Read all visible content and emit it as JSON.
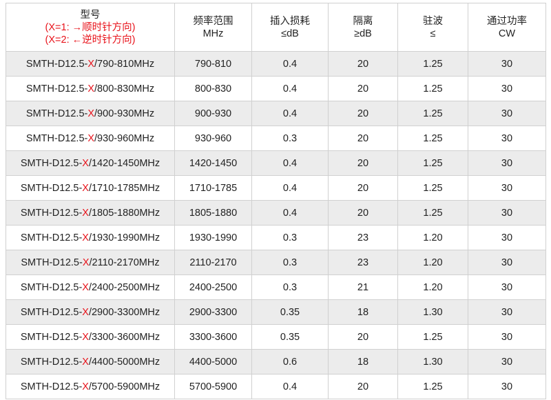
{
  "table": {
    "headers": {
      "model": {
        "title": "型号",
        "note1": "(X=1: →顺时针方向)",
        "note2": "(X=2: ←逆时针方向)"
      },
      "freq": {
        "line1": "频率范围",
        "line2": "MHz"
      },
      "loss": {
        "line1": "插入损耗",
        "line2": "≤dB"
      },
      "iso": {
        "line1": "隔离",
        "line2": "≥dB"
      },
      "vswr": {
        "line1": "驻波",
        "line2": "≤"
      },
      "power": {
        "line1": "通过功率",
        "line2": "CW"
      }
    },
    "accent_color": "#e8121a",
    "rows": [
      {
        "prefix": "SMTH-D12.5-",
        "x": "X",
        "suffix": "/790-810MHz",
        "freq": "790-810",
        "loss": "0.4",
        "iso": "20",
        "vswr": "1.25",
        "power": "30"
      },
      {
        "prefix": "SMTH-D12.5-",
        "x": "X",
        "suffix": "/800-830MHz",
        "freq": "800-830",
        "loss": "0.4",
        "iso": "20",
        "vswr": "1.25",
        "power": "30"
      },
      {
        "prefix": "SMTH-D12.5-",
        "x": "X",
        "suffix": "/900-930MHz",
        "freq": "900-930",
        "loss": "0.4",
        "iso": "20",
        "vswr": "1.25",
        "power": "30"
      },
      {
        "prefix": "SMTH-D12.5-",
        "x": "X",
        "suffix": "/930-960MHz",
        "freq": "930-960",
        "loss": "0.3",
        "iso": "20",
        "vswr": "1.25",
        "power": "30"
      },
      {
        "prefix": "SMTH-D12.5-",
        "x": "X",
        "suffix": "/1420-1450MHz",
        "freq": "1420-1450",
        "loss": "0.4",
        "iso": "20",
        "vswr": "1.25",
        "power": "30"
      },
      {
        "prefix": "SMTH-D12.5-",
        "x": "X",
        "suffix": "/1710-1785MHz",
        "freq": "1710-1785",
        "loss": "0.4",
        "iso": "20",
        "vswr": "1.25",
        "power": "30"
      },
      {
        "prefix": "SMTH-D12.5-",
        "x": "X",
        "suffix": "/1805-1880MHz",
        "freq": "1805-1880",
        "loss": "0.4",
        "iso": "20",
        "vswr": "1.25",
        "power": "30"
      },
      {
        "prefix": "SMTH-D12.5-",
        "x": "X",
        "suffix": "/1930-1990MHz",
        "freq": "1930-1990",
        "loss": "0.3",
        "iso": "23",
        "vswr": "1.20",
        "power": "30"
      },
      {
        "prefix": "SMTH-D12.5-",
        "x": "X",
        "suffix": "/2110-2170MHz",
        "freq": "2110-2170",
        "loss": "0.3",
        "iso": "23",
        "vswr": "1.20",
        "power": "30"
      },
      {
        "prefix": "SMTH-D12.5-",
        "x": "X",
        "suffix": "/2400-2500MHz",
        "freq": "2400-2500",
        "loss": "0.3",
        "iso": "21",
        "vswr": "1.20",
        "power": "30"
      },
      {
        "prefix": "SMTH-D12.5-",
        "x": "X",
        "suffix": "/2900-3300MHz",
        "freq": "2900-3300",
        "loss": "0.35",
        "iso": "18",
        "vswr": "1.30",
        "power": "30"
      },
      {
        "prefix": "SMTH-D12.5-",
        "x": "X",
        "suffix": "/3300-3600MHz",
        "freq": "3300-3600",
        "loss": "0.35",
        "iso": "20",
        "vswr": "1.25",
        "power": "30"
      },
      {
        "prefix": "SMTH-D12.5-",
        "x": "X",
        "suffix": "/4400-5000MHz",
        "freq": "4400-5000",
        "loss": "0.6",
        "iso": "18",
        "vswr": "1.30",
        "power": "30"
      },
      {
        "prefix": "SMTH-D12.5-",
        "x": "X",
        "suffix": "/5700-5900MHz",
        "freq": "5700-5900",
        "loss": "0.4",
        "iso": "20",
        "vswr": "1.25",
        "power": "30"
      }
    ]
  }
}
